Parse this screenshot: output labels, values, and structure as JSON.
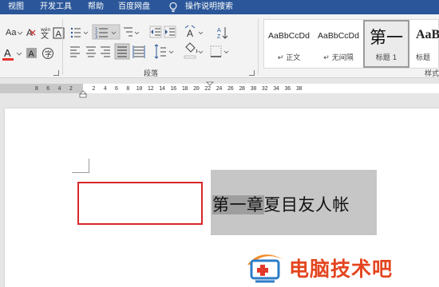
{
  "menu": {
    "items": [
      "视图",
      "开发工具",
      "帮助",
      "百度网盘"
    ],
    "tell_me": "操作说明搜索"
  },
  "ribbon": {
    "group_paragraph": "段落",
    "group_styles_partial": "样式",
    "styles": [
      {
        "preview": "AaBbCcDd",
        "name": "↵ 正文"
      },
      {
        "preview": "AaBbCcDd",
        "name": "↵ 无间隔"
      },
      {
        "preview": "第一",
        "name": "标题 1"
      },
      {
        "preview": "AaB",
        "name": "标题"
      }
    ]
  },
  "ruler": {
    "left_numbers": [
      "8",
      "6",
      "4",
      "2"
    ],
    "right_numbers": [
      "2",
      "4",
      "6",
      "8",
      "10",
      "12",
      "14",
      "16",
      "18",
      "20",
      "22",
      "24",
      "26",
      "28",
      "30",
      "32",
      "34",
      "36",
      "38"
    ]
  },
  "document": {
    "heading_highlighted": "第一章",
    "heading_rest": "夏目友人帐"
  },
  "watermark": {
    "text": "电脑技术吧"
  },
  "colors": {
    "menubar": "#2b579a",
    "font_color_bar": "#e5322d",
    "selection_gray": "#c6c6c6",
    "red_box": "#d6282b",
    "watermark": "#e4451f"
  }
}
